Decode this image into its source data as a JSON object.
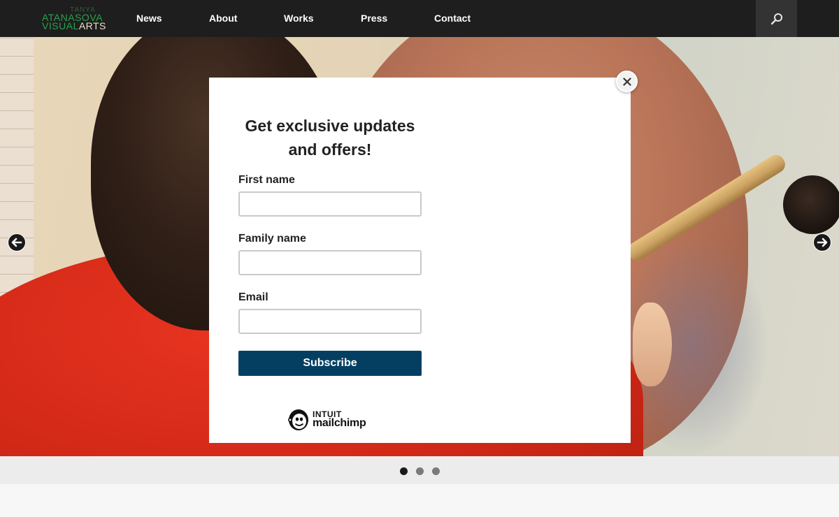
{
  "brand": {
    "line1": "TANYA",
    "line2": "ATANASOVA",
    "line3_a": "VISUAL",
    "line3_b": "ARTS"
  },
  "nav": {
    "items": [
      {
        "label": "News"
      },
      {
        "label": "About"
      },
      {
        "label": "Works"
      },
      {
        "label": "Press"
      },
      {
        "label": "Contact"
      }
    ]
  },
  "icons": {
    "search": "search-icon",
    "prev": "arrow-left-icon",
    "next": "arrow-right-icon",
    "close": "close-icon",
    "mailchimp": "mailchimp-freddie-icon"
  },
  "slider": {
    "total_slides": 3,
    "active_slide": 1
  },
  "modal": {
    "title": "Get exclusive updates and offers!",
    "fields": [
      {
        "label": "First name",
        "value": "",
        "placeholder": ""
      },
      {
        "label": "Family name",
        "value": "",
        "placeholder": ""
      },
      {
        "label": "Email",
        "value": "",
        "placeholder": ""
      }
    ],
    "submit_label": "Subscribe",
    "footer_brand_top": "INTUIT",
    "footer_brand_bottom": "mailchimp"
  },
  "colors": {
    "topbar": "#1e1e1e",
    "search_bg": "#333333",
    "subscribe_bg": "#043f62",
    "brand_green": "#2aa14d",
    "pager_bg": "#ececec"
  }
}
